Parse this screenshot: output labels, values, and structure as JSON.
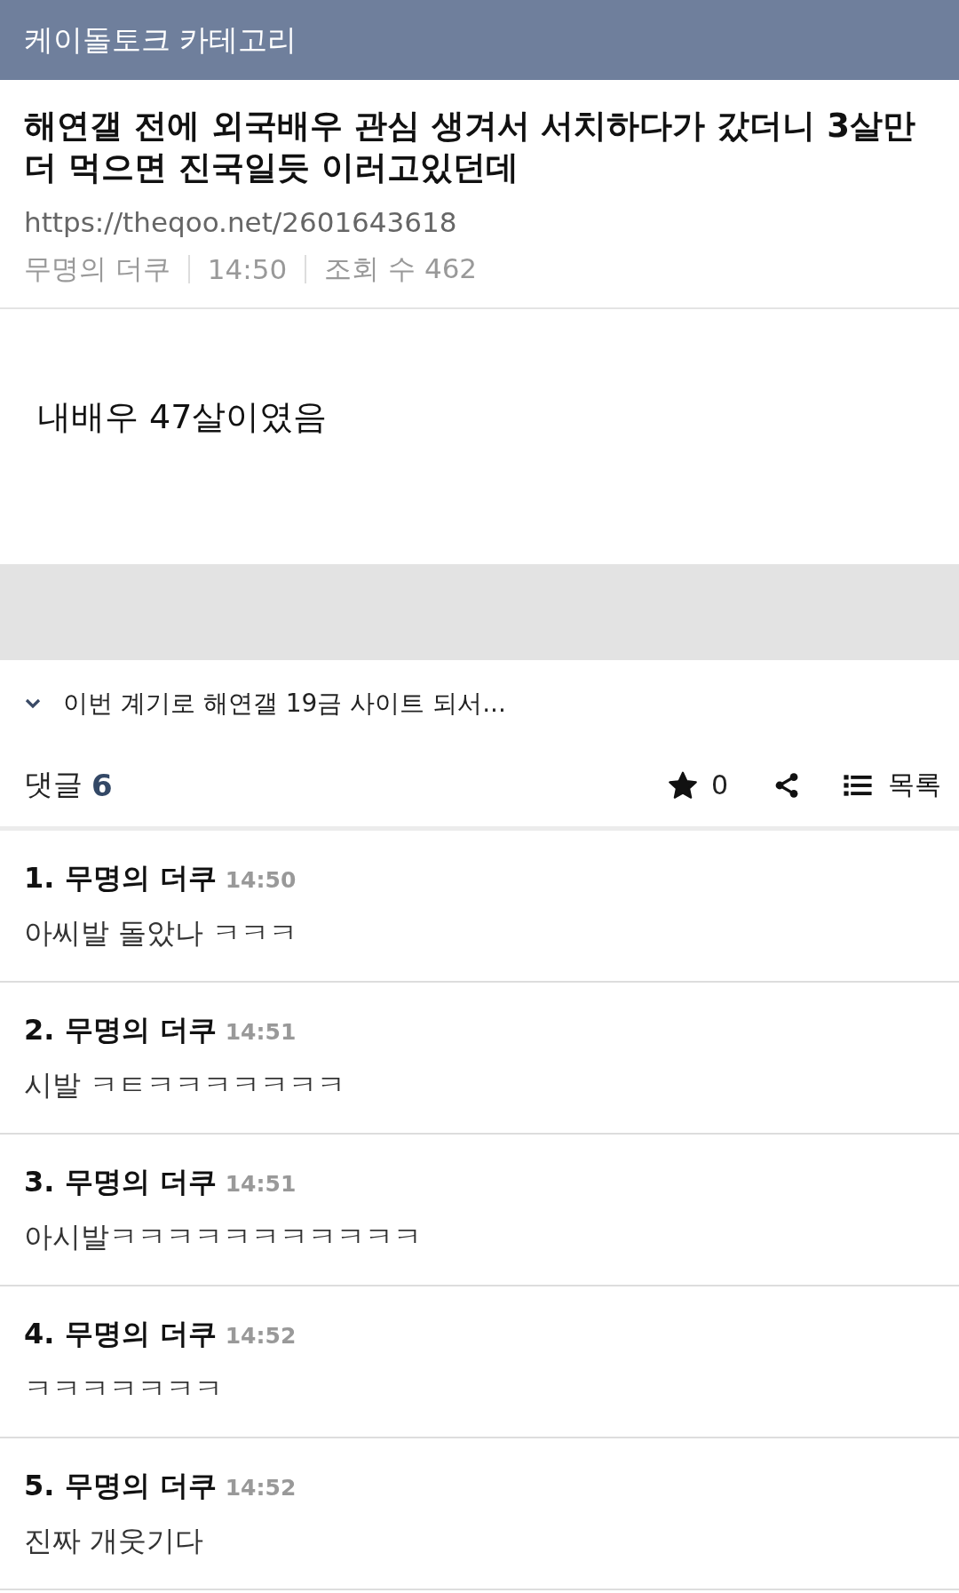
{
  "header": {
    "title": "케이돌토크 카테고리"
  },
  "post": {
    "title": "해연갤 전에 외국배우 관심 생겨서 서치하다가 갔더니 3살만 더 먹으면 진국일듯 이러고있던데",
    "url": "https://theqoo.net/2601643618",
    "author": "무명의 더쿠",
    "time": "14:50",
    "views": "조회 수 462",
    "body": "내배우 47살이였음"
  },
  "related": {
    "title": "이번 계기로 해연갤 19금 사이트 되서..."
  },
  "comments_bar": {
    "label": "댓글",
    "count": "6",
    "stars": "0",
    "list_label": "목록"
  },
  "comments": [
    {
      "number": "1.",
      "author": "무명의 더쿠",
      "time": "14:50",
      "text": "아씨발 돌았나 ㅋㅋㅋ"
    },
    {
      "number": "2.",
      "author": "무명의 더쿠",
      "time": "14:51",
      "text": "시발 ㅋㅌㅋㅋㅋㅋㅋㅋㅋ"
    },
    {
      "number": "3.",
      "author": "무명의 더쿠",
      "time": "14:51",
      "text": "아시발ㅋㅋㅋㅋㅋㅋㅋㅋㅋㅋㅋ"
    },
    {
      "number": "4.",
      "author": "무명의 더쿠",
      "time": "14:52",
      "text": "ㅋㅋㅋㅋㅋㅋㅋ"
    },
    {
      "number": "5.",
      "author": "무명의 더쿠",
      "time": "14:52",
      "text": "진짜 개웃기다"
    }
  ]
}
